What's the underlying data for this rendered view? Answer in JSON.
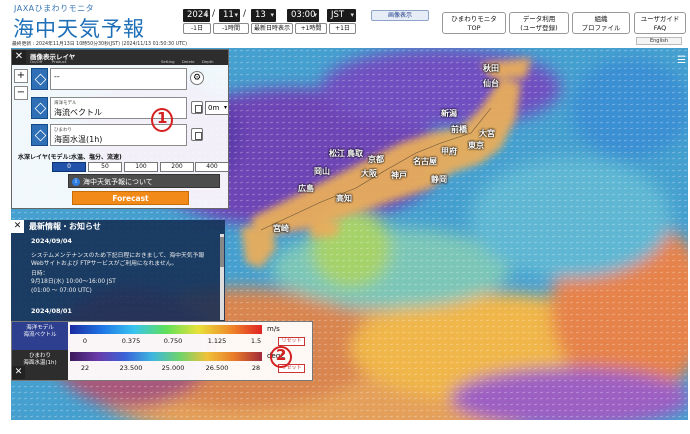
{
  "brand": {
    "subtitle": "JAXAひまわりモニタ",
    "title": "海中天気予報"
  },
  "updated": "最終更新 : 2024年11月13日 10時50分30秒(JST) (2024/11/13 01:50:30 UTC)",
  "datetime": {
    "year": "2024",
    "month": "11",
    "day": "13",
    "time": "03:00",
    "zone": "JST"
  },
  "time_buttons": [
    "-1日",
    "-1時間",
    "最新日時表示",
    "+1時間",
    "+1日"
  ],
  "image_display_button": "画像表示",
  "nav_buttons": [
    {
      "line1": "ひまわりモニタ",
      "line2": "TOP"
    },
    {
      "line1": "データ利用",
      "line2": "(ユーザ登録)"
    },
    {
      "line1": "組織",
      "line2": "プロファイル"
    },
    {
      "line1": "ユーザガイド",
      "line2": "FAQ"
    }
  ],
  "language": "English",
  "layer_panel": {
    "title": "画像表示レイヤ",
    "columns": [
      "On/Off",
      "Product",
      "Setting",
      "Delete",
      "Depth"
    ],
    "rows": [
      {
        "small": "",
        "name": "--",
        "depth": ""
      },
      {
        "small": "海洋モデル",
        "name": "海流ベクトル",
        "depth": "0m"
      },
      {
        "small": "ひまわり",
        "name": "海面水温(1h)",
        "depth": ""
      }
    ],
    "water_layer_label": "水深レイヤ(モデル:水温、塩分、流速)",
    "depth_buttons": [
      "0",
      "50",
      "100",
      "200",
      "400"
    ],
    "depth_selected": "0",
    "info_text": "海中天気予報について",
    "forecast_button": "Forecast"
  },
  "news": {
    "title": "最新情報・お知らせ",
    "items": [
      {
        "date": "2024/09/04",
        "lines": [
          "システムメンテナンスのため下記日程におきまして、海中天気予報",
          "Webサイトおよび FTPサービスがご利用になれません。",
          "日時：",
          "9月18日(水) 10:00〜16:00 JST",
          "(01:00 〜 07:00 UTC)"
        ]
      },
      {
        "date": "2024/08/01",
        "lines": []
      }
    ]
  },
  "legend": {
    "current": {
      "label_top": "海洋モデル",
      "label_bottom": "海流ベクトル",
      "unit": "m/s",
      "ticks": [
        "0",
        "0.375",
        "0.750",
        "1.125",
        "1.5"
      ],
      "reset": "リセット"
    },
    "sst": {
      "label_top": "ひまわり",
      "label_bottom": "海面水温(1h)",
      "unit": "degC",
      "ticks": [
        "22",
        "23.500",
        "25.000",
        "26.500",
        "28"
      ],
      "reset": "リセット"
    }
  },
  "annotations": [
    "1",
    "2"
  ],
  "map_labels": [
    "広島",
    "岡山",
    "大阪",
    "京都",
    "名古屋",
    "静岡",
    "東京",
    "新潟",
    "仙台",
    "前橋",
    "甲府",
    "松江",
    "鳥取",
    "神戸",
    "高知",
    "宮崎",
    "大宮",
    "秋田"
  ],
  "colors": {
    "accent": "#1d6fb8",
    "forecast": "#f28a1a",
    "annotation": "#d42020"
  }
}
